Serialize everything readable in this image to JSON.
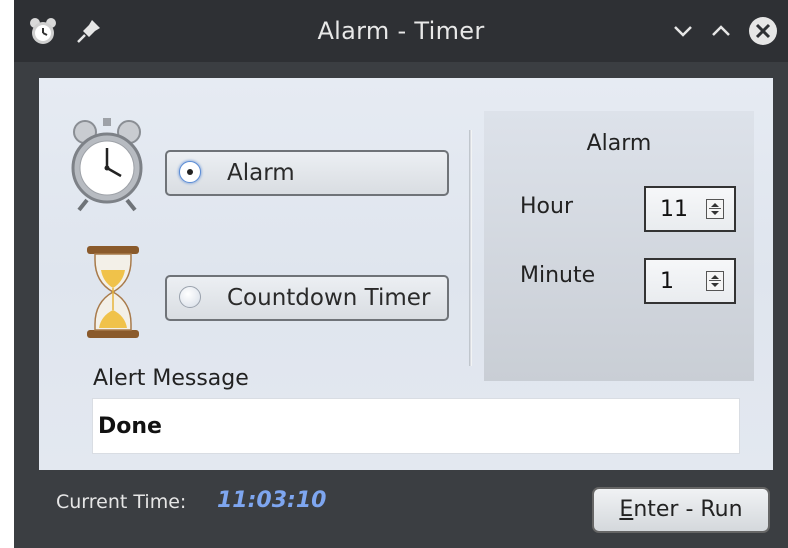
{
  "window": {
    "title": "Alarm - Timer",
    "icons": {
      "app": "alarm-clock-icon",
      "pin": "pin-icon",
      "minimize": "chevron-down-icon",
      "maximize": "chevron-up-icon",
      "close": "close-icon"
    }
  },
  "modes": [
    {
      "label": "Alarm",
      "checked": true,
      "icon": "alarm-clock-icon"
    },
    {
      "label": "Countdown Timer",
      "checked": false,
      "icon": "hourglass-icon"
    }
  ],
  "alarm_panel": {
    "title": "Alarm",
    "hour_label": "Hour",
    "hour_value": "11",
    "minute_label": "Minute",
    "minute_value": "1"
  },
  "alert": {
    "label": "Alert Message",
    "value": "Done"
  },
  "status": {
    "label": "Current Time:",
    "time": "11:03:10"
  },
  "run_button": {
    "accel": "E",
    "rest": "nter - Run"
  },
  "colors": {
    "titlebar": "#2e3034",
    "window": "#3b3e42",
    "time_text": "#7ea6f0",
    "close_button": "#e6e6e6"
  }
}
